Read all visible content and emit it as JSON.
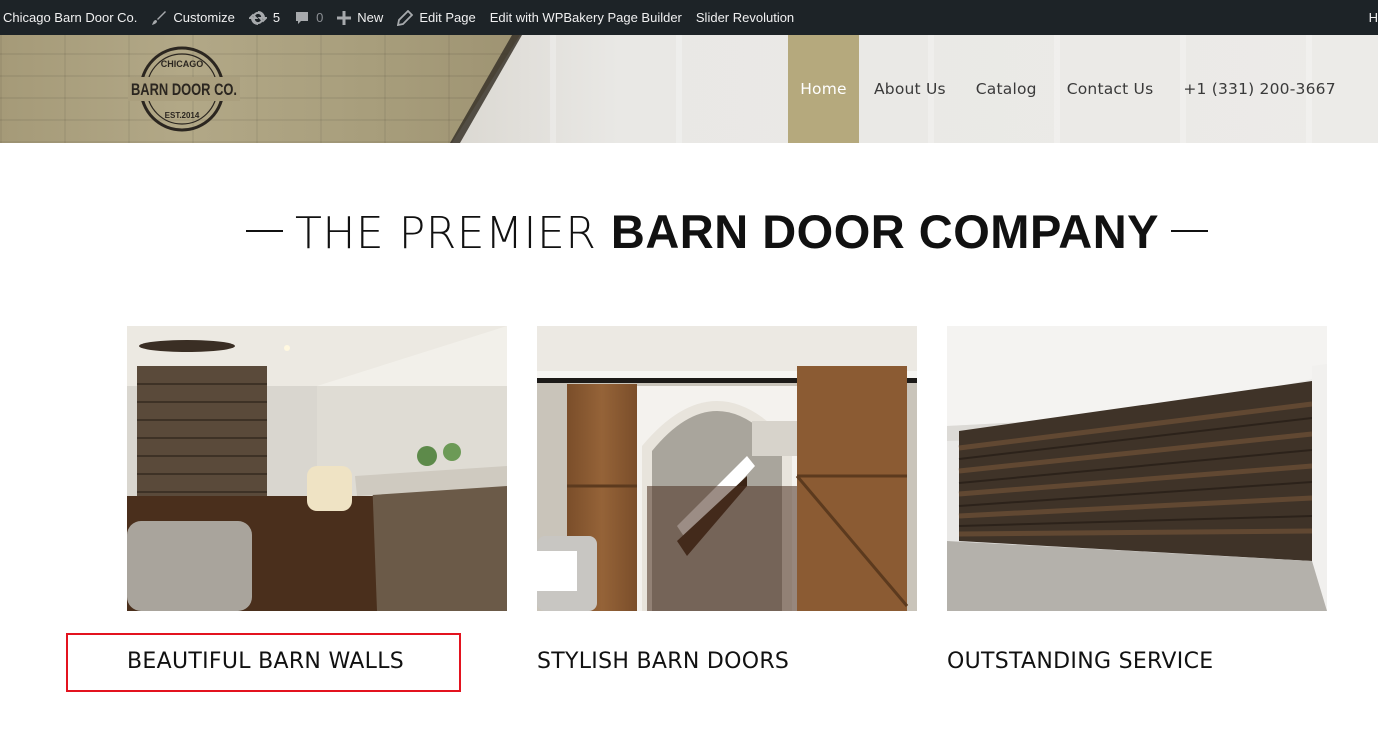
{
  "admin_bar": {
    "site_name": "Chicago Barn Door Co.",
    "customize": "Customize",
    "updates_count": "5",
    "comments_count": "0",
    "new": "New",
    "edit_page": "Edit Page",
    "wpbakery": "Edit with WPBakery Page Builder",
    "slider": "Slider Revolution",
    "howdy_partial": "H"
  },
  "header": {
    "logo": {
      "top": "CHICAGO",
      "main": "BARN DOOR CO.",
      "bottom": "EST.2014"
    },
    "nav": [
      {
        "label": "Home",
        "active": true
      },
      {
        "label": "About Us",
        "active": false
      },
      {
        "label": "Catalog",
        "active": false
      },
      {
        "label": "Contact Us",
        "active": false
      },
      {
        "label": "+1 (331) 200-3667",
        "active": false
      }
    ]
  },
  "hero": {
    "light": "THE PREMIER ",
    "bold": "BARN DOOR COMPANY"
  },
  "features": [
    {
      "title": "BEAUTIFUL BARN WALLS",
      "image": "barn-wall-living-room-photo"
    },
    {
      "title": "STYLISH BARN DOORS",
      "image": "sliding-barn-doors-photo"
    },
    {
      "title": "OUTSTANDING SERVICE",
      "image": "basement-barn-wall-photo"
    }
  ],
  "colors": {
    "admin_bar_bg": "#1d2327",
    "nav_active_bg": "#b5a97d",
    "highlight": "#e3131f"
  }
}
